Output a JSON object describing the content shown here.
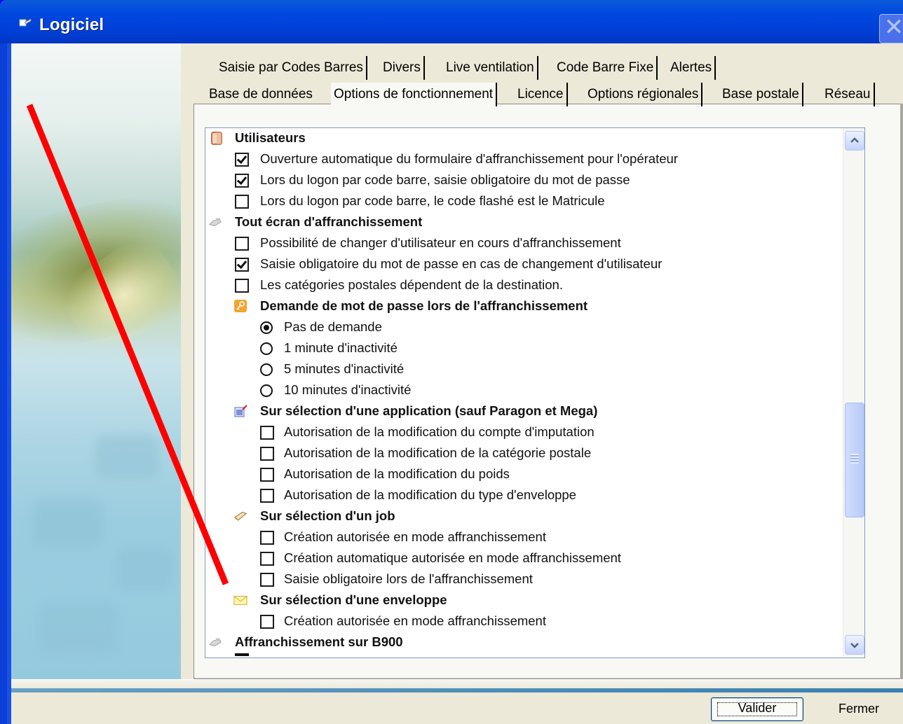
{
  "window": {
    "title": "Logiciel",
    "close_symbol": "✕"
  },
  "tabs": {
    "row1": [
      {
        "label": "Saisie par Codes Barres"
      },
      {
        "label": "Divers"
      },
      {
        "label": "Live ventilation"
      },
      {
        "label": "Code Barre Fixe"
      },
      {
        "label": "Alertes"
      }
    ],
    "row2": [
      {
        "label": "Base de données"
      },
      {
        "label": "Options de fonctionnement",
        "active": true
      },
      {
        "label": "Licence"
      },
      {
        "label": "Options régionales"
      },
      {
        "label": "Base postale"
      },
      {
        "label": "Réseau"
      }
    ]
  },
  "tree": {
    "users": {
      "title": "Utilisateurs",
      "items": [
        {
          "label": "Ouverture automatique du formulaire d'affranchissement pour l'opérateur",
          "checked": true
        },
        {
          "label": "Lors du logon par code barre, saisie obligatoire du mot de passe",
          "checked": true
        },
        {
          "label": "Lors du logon par code barre, le code flashé est le Matricule",
          "checked": false
        }
      ]
    },
    "screen": {
      "title": "Tout écran d'affranchissement",
      "items": [
        {
          "label": "Possibilité de changer d'utilisateur en cours d'affranchissement",
          "checked": false
        },
        {
          "label": "Saisie obligatoire du mot de passe en cas de changement d'utilisateur",
          "checked": true
        },
        {
          "label": "Les catégories postales dépendent de la destination.",
          "checked": false
        }
      ]
    },
    "password": {
      "title": "Demande de mot de passe lors de l'affranchissement",
      "options": [
        {
          "label": "Pas de demande",
          "selected": true
        },
        {
          "label": "1 minute d'inactivité",
          "selected": false
        },
        {
          "label": "5 minutes d'inactivité",
          "selected": false
        },
        {
          "label": "10 minutes d'inactivité",
          "selected": false
        }
      ]
    },
    "application": {
      "title": "Sur sélection d'une application  (sauf Paragon et Mega)",
      "items": [
        {
          "label": "Autorisation de la modification du compte d'imputation",
          "checked": false
        },
        {
          "label": "Autorisation de la modification de la catégorie postale",
          "checked": false
        },
        {
          "label": "Autorisation de la modification du poids",
          "checked": false
        },
        {
          "label": "Autorisation de la modification du type d'enveloppe",
          "checked": false
        }
      ]
    },
    "job": {
      "title": "Sur sélection d'un job",
      "items": [
        {
          "label": "Création autorisée en mode affranchissement",
          "checked": false
        },
        {
          "label": "Création automatique autorisée en mode affranchissement",
          "checked": false
        },
        {
          "label": "Saisie obligatoire lors de l'affranchissement",
          "checked": false
        }
      ]
    },
    "envelope": {
      "title": "Sur sélection d'une enveloppe",
      "items": [
        {
          "label": "Création autorisée en mode affranchissement",
          "checked": false
        }
      ]
    },
    "b900": {
      "title": "Affranchissement sur B900"
    }
  },
  "buttons": {
    "validate": "Valider",
    "close": "Fermer"
  },
  "colors": {
    "desktop": "#0c00f0",
    "titlebar": "#0046e0",
    "annotation": "#ff0000"
  }
}
